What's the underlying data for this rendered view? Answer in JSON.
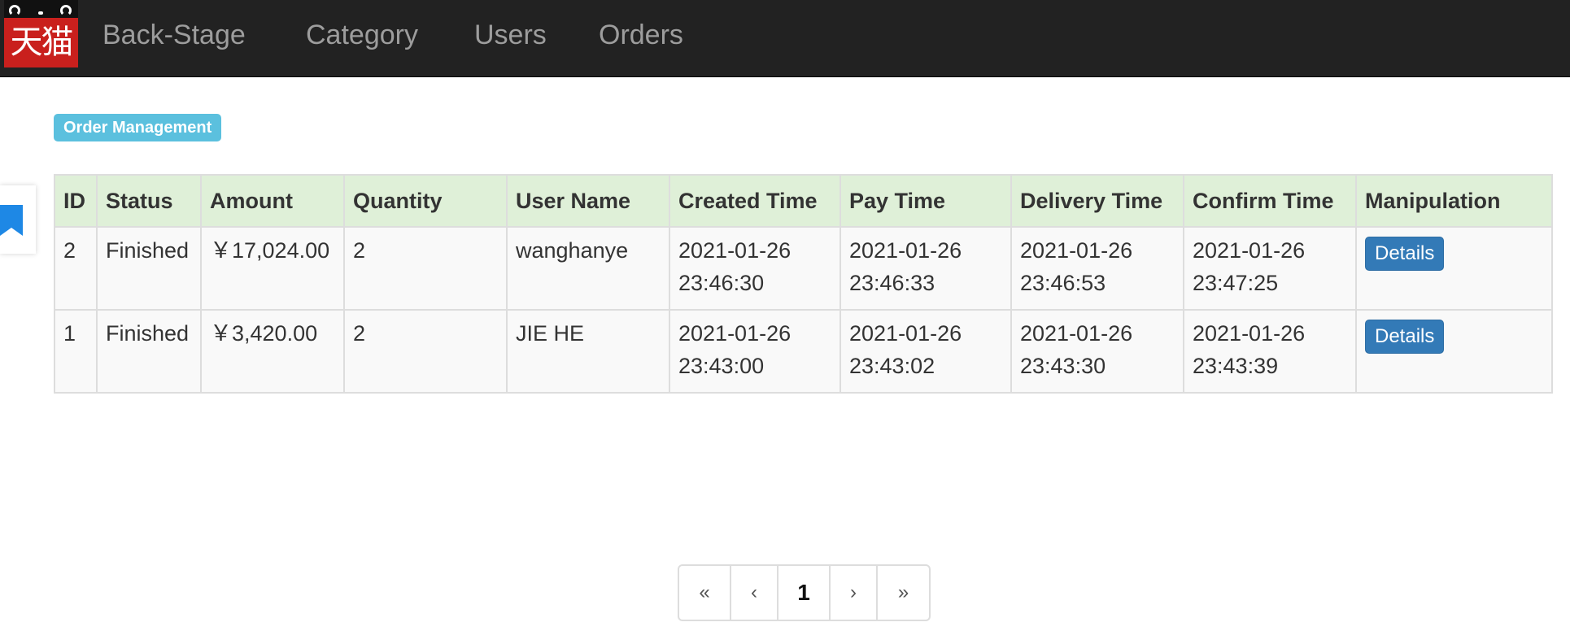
{
  "brand": {
    "logo_text": "天猫",
    "logo_icon": "tmall-cat-logo"
  },
  "nav": {
    "items": [
      {
        "label": "Back-Stage"
      },
      {
        "label": "Category"
      },
      {
        "label": "Users"
      },
      {
        "label": "Orders"
      }
    ]
  },
  "side": {
    "bookmark_icon": "bookmark-icon"
  },
  "section": {
    "label": "Order Management"
  },
  "table": {
    "headers": [
      "ID",
      "Status",
      "Amount",
      "Quantity",
      "User Name",
      "Created Time",
      "Pay Time",
      "Delivery Time",
      "Confirm Time",
      "Manipulation"
    ],
    "rows": [
      {
        "id": "2",
        "status": "Finished",
        "amount": "￥17,024.00",
        "quantity": "2",
        "user": "wanghanye",
        "created_date": "2021-01-26",
        "created_time": "23:46:30",
        "pay_date": "2021-01-26",
        "pay_time": "23:46:33",
        "delivery_date": "2021-01-26",
        "delivery_time": "23:46:53",
        "confirm_date": "2021-01-26",
        "confirm_time": "23:47:25",
        "action": "Details"
      },
      {
        "id": "1",
        "status": "Finished",
        "amount": "￥3,420.00",
        "quantity": "2",
        "user": "JIE HE",
        "created_date": "2021-01-26",
        "created_time": "23:43:00",
        "pay_date": "2021-01-26",
        "pay_time": "23:43:02",
        "delivery_date": "2021-01-26",
        "delivery_time": "23:43:30",
        "confirm_date": "2021-01-26",
        "confirm_time": "23:43:39",
        "action": "Details"
      }
    ]
  },
  "pagination": {
    "first": "«",
    "prev": "‹",
    "current": "1",
    "next": "›",
    "last": "»"
  },
  "colors": {
    "navbar": "#222222",
    "header_row": "#dff0d8",
    "label_badge": "#5bc0de",
    "primary_button": "#337ab7",
    "logo_red": "#c9201d"
  }
}
